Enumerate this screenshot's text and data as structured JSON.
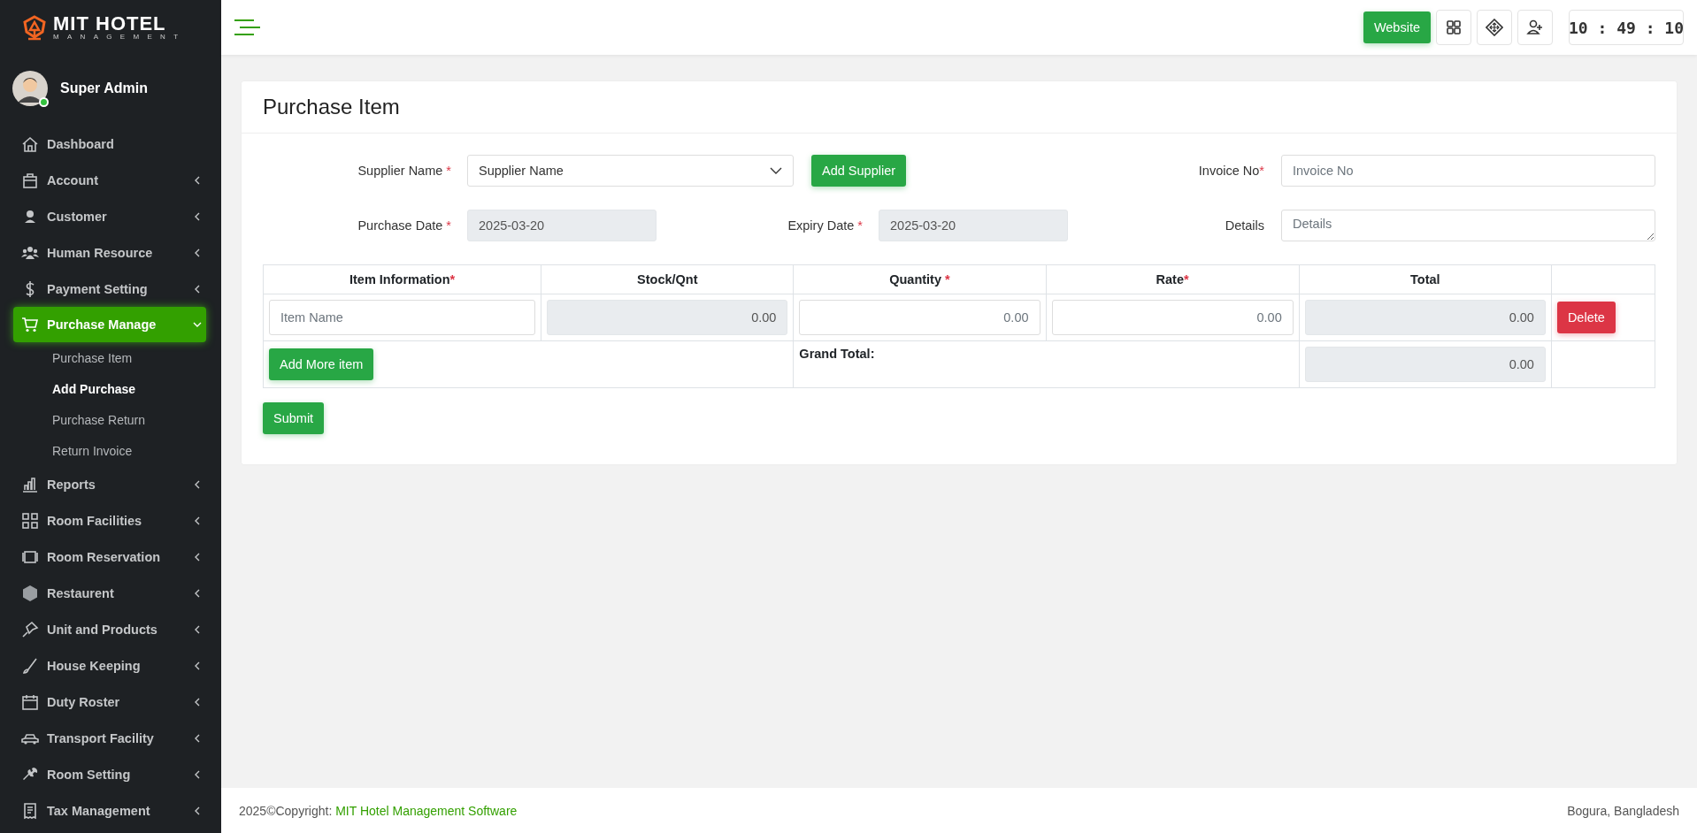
{
  "brand": {
    "name": "MIT HOTEL",
    "tagline": "MANAGEMENT"
  },
  "user": {
    "name": "Super Admin",
    "online": true
  },
  "sidebar": {
    "items": [
      {
        "label": "Dashboard",
        "kind": "link",
        "selected": false
      },
      {
        "label": "Account",
        "kind": "menu",
        "expanded": false,
        "selected": false
      },
      {
        "label": "Customer",
        "kind": "menu",
        "expanded": false,
        "selected": false
      },
      {
        "label": "Human Resource",
        "kind": "menu",
        "expanded": false,
        "selected": false
      },
      {
        "label": "Payment Setting",
        "kind": "menu",
        "expanded": false,
        "selected": false
      },
      {
        "label": "Purchase Manage",
        "kind": "menu",
        "expanded": true,
        "selected": true,
        "children": [
          {
            "label": "Purchase Item",
            "selected": false
          },
          {
            "label": "Add Purchase",
            "selected": true
          },
          {
            "label": "Purchase Return",
            "selected": false
          },
          {
            "label": "Return Invoice",
            "selected": false
          }
        ]
      },
      {
        "label": "Reports",
        "kind": "menu",
        "expanded": false,
        "selected": false
      },
      {
        "label": "Room Facilities",
        "kind": "menu",
        "expanded": false,
        "selected": false
      },
      {
        "label": "Room Reservation",
        "kind": "menu",
        "expanded": false,
        "selected": false
      },
      {
        "label": "Restaurent",
        "kind": "menu",
        "expanded": false,
        "selected": false
      },
      {
        "label": "Unit and Products",
        "kind": "menu",
        "expanded": false,
        "selected": false
      },
      {
        "label": "House Keeping",
        "kind": "menu",
        "expanded": false,
        "selected": false
      },
      {
        "label": "Duty Roster",
        "kind": "menu",
        "expanded": false,
        "selected": false
      },
      {
        "label": "Transport Facility",
        "kind": "menu",
        "expanded": false,
        "selected": false
      },
      {
        "label": "Room Setting",
        "kind": "menu",
        "expanded": false,
        "selected": false
      },
      {
        "label": "Tax Management",
        "kind": "menu",
        "expanded": false,
        "selected": false
      }
    ]
  },
  "topbar": {
    "website_button": "Website",
    "clock": "10 : 49 : 10"
  },
  "page": {
    "title": "Purchase Item"
  },
  "form": {
    "supplier": {
      "label": "Supplier Name",
      "mark": " *",
      "value": "Supplier Name"
    },
    "add_supplier": "Add Supplier",
    "invoice": {
      "label": "Invoice No",
      "mark": "*",
      "placeholder": "Invoice No",
      "readonly": false
    },
    "purchase_date": {
      "label": "Purchase Date",
      "mark": " *",
      "value": "2025-03-20",
      "readonly": true
    },
    "expiry_date": {
      "label": "Expiry Date",
      "mark": " *",
      "value": "2025-03-20",
      "readonly": true
    },
    "details": {
      "label": "Details",
      "placeholder": "Details"
    }
  },
  "table": {
    "columns": [
      {
        "label": "Item Information",
        "mark": "*"
      },
      {
        "label": "Stock/Qnt"
      },
      {
        "label": "Quantity",
        "mark": " *"
      },
      {
        "label": "Rate",
        "mark": "*"
      },
      {
        "label": "Total"
      }
    ],
    "rows": [
      {
        "cells": [
          {
            "placeholder": "Item Name",
            "readonly": false
          },
          {
            "value": "0.00",
            "readonly": true
          },
          {
            "placeholder": "0.00",
            "readonly": false
          },
          {
            "placeholder": "0.00",
            "readonly": false
          },
          {
            "value": "0.00",
            "readonly": true
          }
        ],
        "delete": "Delete"
      }
    ],
    "add_more": "Add More item",
    "grand_total_label": "Grand Total:",
    "grand_total": "0.00"
  },
  "submit": "Submit",
  "footer": {
    "copyright": "2025©Copyright: ",
    "link": "MIT Hotel Management Software",
    "location": "Bogura, Bangladesh"
  }
}
